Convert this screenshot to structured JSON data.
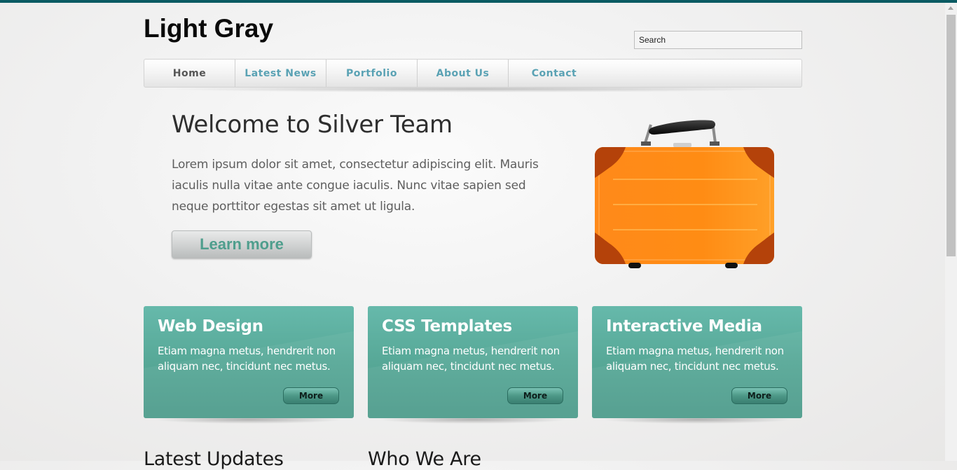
{
  "site": {
    "title": "Light Gray"
  },
  "search": {
    "placeholder": "Search"
  },
  "nav": {
    "items": [
      {
        "label": "Home",
        "active": true
      },
      {
        "label": "Latest News",
        "active": false
      },
      {
        "label": "Portfolio",
        "active": false
      },
      {
        "label": "About Us",
        "active": false
      },
      {
        "label": "Contact",
        "active": false
      }
    ]
  },
  "hero": {
    "title": "Welcome to Silver Team",
    "text": "Lorem ipsum dolor sit amet, consectetur adipiscing elit. Mauris iaculis nulla vitae ante congue iaculis. Nunc vitae sapien sed neque porttitor egestas sit amet ut ligula.",
    "button_label": "Learn more",
    "image_icon": "suitcase-image"
  },
  "features": [
    {
      "title": "Web Design",
      "text": "Etiam magna metus, hendrerit non aliquam nec, tincidunt nec metus.",
      "button_label": "More"
    },
    {
      "title": "CSS Templates",
      "text": "Etiam magna metus, hendrerit non aliquam nec, tincidunt nec metus.",
      "button_label": "More"
    },
    {
      "title": "Interactive Media",
      "text": "Etiam magna metus, hendrerit non aliquam nec, tincidunt nec metus.",
      "button_label": "More"
    }
  ],
  "sections": {
    "latest_updates": "Latest Updates",
    "who_we_are": "Who We Are"
  },
  "colors": {
    "top_bar": "#0b5b63",
    "nav_link": "#5aa2b4",
    "feature_box": "#5aab9a",
    "learn_more_text": "#4f9e8d"
  }
}
